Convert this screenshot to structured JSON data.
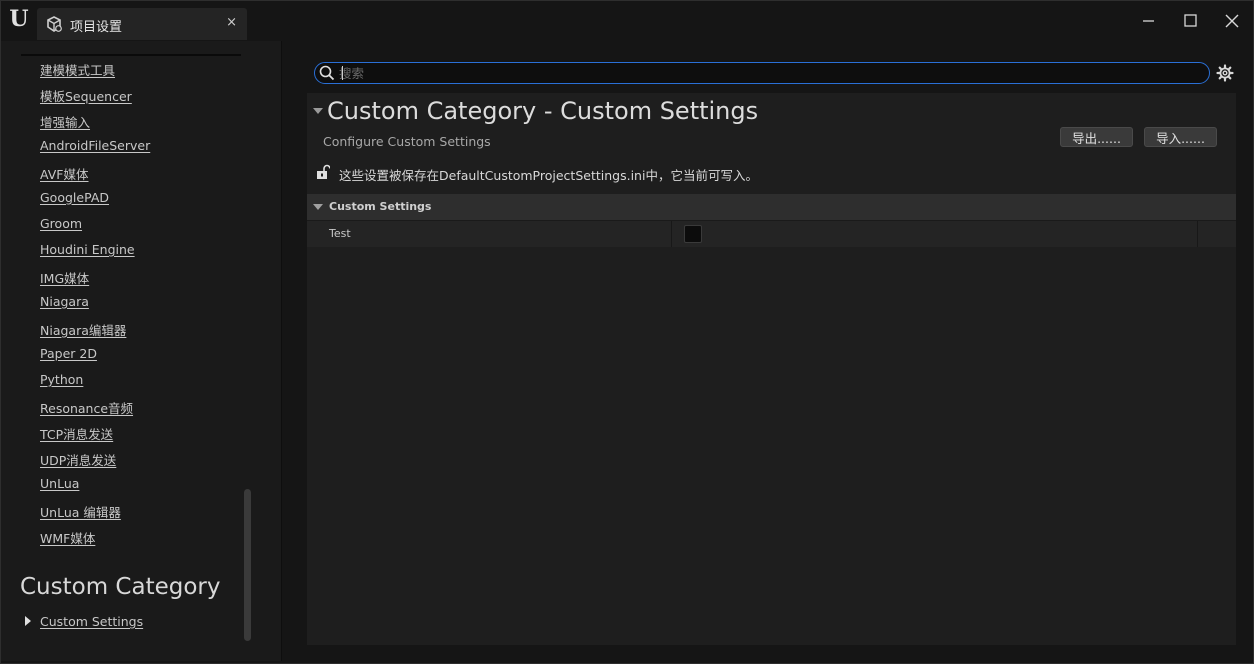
{
  "window": {
    "tab_title": "项目设置",
    "tab_close": "×"
  },
  "sidebar": {
    "items": [
      {
        "label": "建模模式工具"
      },
      {
        "label": "模板Sequencer"
      },
      {
        "label": "增强输入"
      },
      {
        "label": "AndroidFileServer"
      },
      {
        "label": "AVF媒体"
      },
      {
        "label": "GooglePAD"
      },
      {
        "label": "Groom"
      },
      {
        "label": "Houdini Engine"
      },
      {
        "label": "IMG媒体"
      },
      {
        "label": "Niagara"
      },
      {
        "label": "Niagara编辑器"
      },
      {
        "label": "Paper 2D"
      },
      {
        "label": "Python"
      },
      {
        "label": "Resonance音频"
      },
      {
        "label": "TCP消息发送"
      },
      {
        "label": "UDP消息发送"
      },
      {
        "label": "UnLua"
      },
      {
        "label": "UnLua 编辑器"
      },
      {
        "label": "WMF媒体"
      }
    ],
    "category_title": "Custom Category",
    "category_item": "Custom Settings"
  },
  "search": {
    "placeholder": "搜索",
    "value": ""
  },
  "header": {
    "title": "Custom Category - Custom Settings",
    "subtitle": "Configure Custom Settings",
    "export_label": "导出......",
    "import_label": "导入......",
    "info_text": "这些设置被保存在DefaultCustomProjectSettings.ini中，它当前可写入。"
  },
  "section": {
    "title": "Custom Settings",
    "rows": [
      {
        "label": "Test",
        "checked": false
      }
    ]
  },
  "colors": {
    "accent": "#2a6fd6",
    "background": "#151515",
    "panel": "#1e1e1e"
  },
  "icons": {
    "app": "unreal-logo-icon",
    "tab": "project-settings-icon",
    "search": "search-icon",
    "settings": "gear-icon",
    "lock": "unlocked-icon"
  }
}
